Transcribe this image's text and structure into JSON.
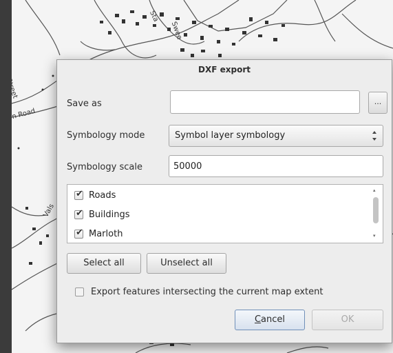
{
  "map": {
    "labels": [
      "Street",
      "n Road",
      "Vals",
      "Sta",
      "Swee"
    ]
  },
  "dialog": {
    "title": "DXF export",
    "save_as": {
      "label": "Save as",
      "value": "",
      "browse_label": "..."
    },
    "symbology_mode": {
      "label": "Symbology mode",
      "value": "Symbol layer symbology"
    },
    "symbology_scale": {
      "label": "Symbology scale",
      "value": "50000"
    },
    "layers": [
      {
        "name": "Roads",
        "checked": true
      },
      {
        "name": "Buildings",
        "checked": true
      },
      {
        "name": "Marloth",
        "checked": true
      }
    ],
    "select_all_label": "Select all",
    "unselect_all_label": "Unselect all",
    "intersect_option": {
      "label": "Export features intersecting the current map extent",
      "checked": false
    },
    "cancel_label": "Cancel",
    "ok_label": "OK"
  }
}
